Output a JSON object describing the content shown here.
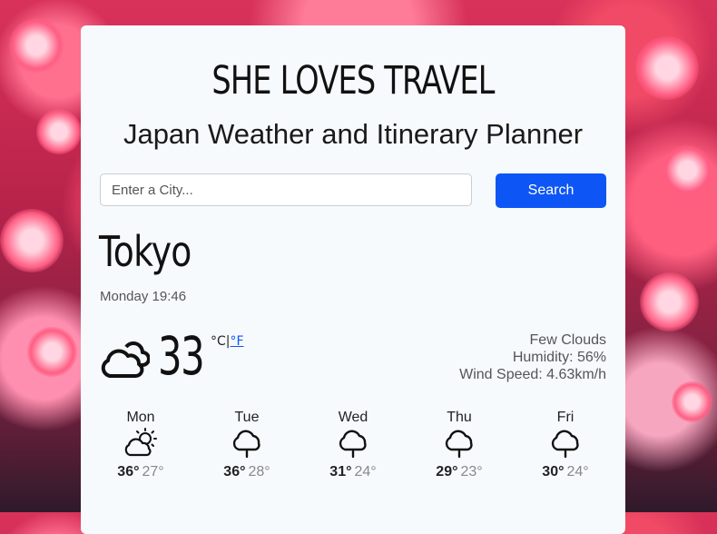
{
  "header": {
    "brand": "SHE LOVES TRAVEL",
    "subtitle": "Japan Weather and Itinerary Planner"
  },
  "search": {
    "placeholder": "Enter a City...",
    "button_label": "Search"
  },
  "current": {
    "city": "Tokyo",
    "datetime": "Monday 19:46",
    "icon": "cloudy-icon",
    "temperature": "33",
    "unit_celsius": "°C",
    "unit_separator": "|",
    "unit_fahrenheit": "°F",
    "description": "Few Clouds",
    "humidity": "Humidity: 56%",
    "wind": "Wind Speed: 4.63km/h"
  },
  "forecast": [
    {
      "day": "Mon",
      "icon": "sun-cloud-icon",
      "high": "36°",
      "low": "27°"
    },
    {
      "day": "Tue",
      "icon": "rain-cloud-icon",
      "high": "36°",
      "low": "28°"
    },
    {
      "day": "Wed",
      "icon": "rain-cloud-icon",
      "high": "31°",
      "low": "24°"
    },
    {
      "day": "Thu",
      "icon": "rain-cloud-icon",
      "high": "29°",
      "low": "23°"
    },
    {
      "day": "Fri",
      "icon": "rain-cloud-icon",
      "high": "30°",
      "low": "24°"
    }
  ],
  "colors": {
    "accent": "#0d56f5",
    "card_background": "#f7fafc",
    "background": "#d9325a"
  }
}
